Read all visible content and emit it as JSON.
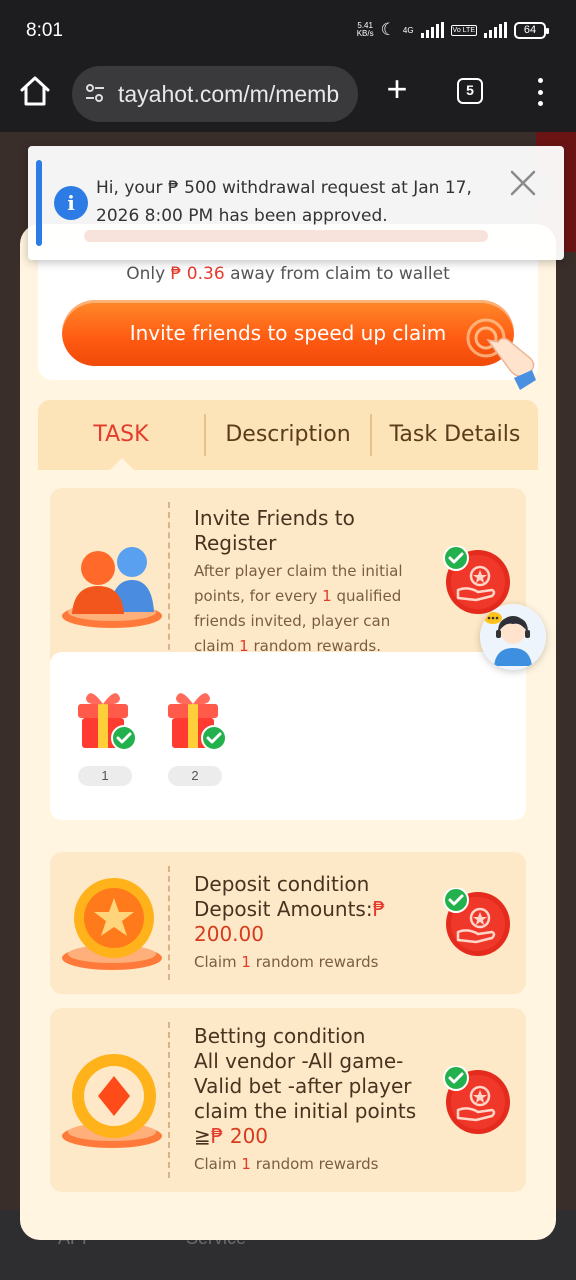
{
  "status_bar": {
    "time": "8:01",
    "speed_value": "5.41",
    "speed_unit": "KB/s",
    "network": "4G",
    "volte": "Vo LTE",
    "battery": "64"
  },
  "browser": {
    "url": "tayahot.com/m/memb",
    "tab_count": "5"
  },
  "backdrop": {
    "nav_app": "APP",
    "nav_service": "Service"
  },
  "toast": {
    "message": "Hi, your ₱ 500 withdrawal request at Jan 17, 2026 8:00 PM has been approved."
  },
  "claim": {
    "prefix": "Only",
    "currency": "₱",
    "amount": "0.36",
    "suffix": "away from claim to wallet",
    "invite_button": "Invite friends to speed up claim"
  },
  "tabs": [
    {
      "label": "TASK",
      "active": true
    },
    {
      "label": "Description",
      "active": false
    },
    {
      "label": "Task Details",
      "active": false
    }
  ],
  "tasks": {
    "invite": {
      "title_line1": "Invite Friends to",
      "title_line2": "Register",
      "desc_line1": "After player claim the initial",
      "desc_line2a": "points, for every",
      "desc_count": "1",
      "desc_line2b": "qualified",
      "desc_line3": "friends invited, player can",
      "desc_line4a": "claim",
      "desc_line4_count": "1",
      "desc_line4b": "random rewards."
    },
    "rewards": [
      {
        "label": "1",
        "claimed": true
      },
      {
        "label": "2",
        "claimed": true
      }
    ],
    "deposit": {
      "title": "Deposit condition",
      "amount_label": "Deposit Amounts:",
      "currency": "₱",
      "amount": "200.00",
      "claim_a": "Claim",
      "claim_count": "1",
      "claim_b": "random rewards"
    },
    "betting": {
      "title": "Betting condition",
      "line1": "All vendor -All game-",
      "line2": "Valid bet -after player",
      "line3": "claim the initial points",
      "threshold_prefix": "≧",
      "currency": "₱",
      "amount": "200",
      "claim_a": "Claim",
      "claim_count": "1",
      "claim_b": "random rewards"
    }
  },
  "colors": {
    "accent_red": "#e53b2c",
    "invite_orange": "#ff5a12",
    "modal_bg": "#fff5e1",
    "card_bg": "#fde9c7",
    "info_blue": "#2d7be5",
    "check_green": "#22b14c"
  },
  "icons": [
    "home-icon",
    "tune-icon",
    "plus-icon",
    "tabs-icon",
    "more-vert-icon",
    "info-icon",
    "close-icon",
    "pointing-hand-icon",
    "friends-icon",
    "claim-hand-badge-icon",
    "checkmark-icon",
    "gift-icon",
    "coin-star-icon",
    "chip-diamond-icon",
    "support-agent-icon"
  ]
}
